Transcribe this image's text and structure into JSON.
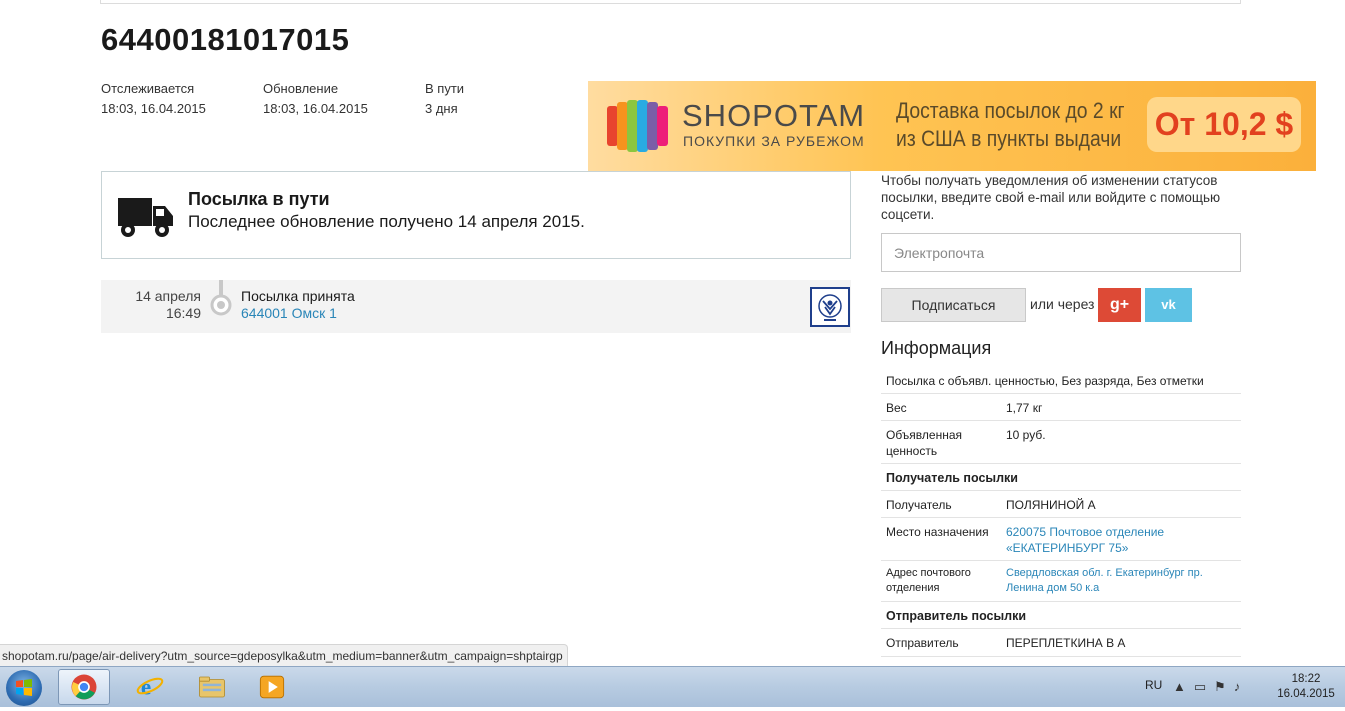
{
  "tracking": {
    "number": "64400181017015",
    "meta": [
      {
        "label": "Отслеживается",
        "value": "18:03, 16.04.2015"
      },
      {
        "label": "Обновление",
        "value": "18:03, 16.04.2015"
      },
      {
        "label": "В пути",
        "value": "3 дня"
      }
    ]
  },
  "banner": {
    "brand": "SHOPOTAM",
    "tagline": "ПОКУПКИ ЗА РУБЕЖОМ",
    "promo_line1": "Доставка посылок до 2 кг",
    "promo_line2": "из США в пункты выдачи",
    "price": "От 10,2 $"
  },
  "status": {
    "title": "Посылка в пути",
    "description": "Последнее обновление получено 14 апреля 2015."
  },
  "events": [
    {
      "date": "14 апреля",
      "time": "16:49",
      "name": "Посылка принята",
      "location": "644001 Омск 1"
    }
  ],
  "subscribe": {
    "text": "Чтобы получать уведомления об изменении статусов посылки, введите свой e-mail или войдите с помощью соцсети.",
    "email_placeholder": "Электропочта",
    "button_label": "Подписаться",
    "or_via": "или через",
    "gplus_label": "g+",
    "vk_label": "vk"
  },
  "info": {
    "title": "Информация",
    "parcel_type": "Посылка с объявл. ценностью, Без разряда, Без отметки",
    "weight_label": "Вес",
    "weight_value": "1,77 кг",
    "declared_label_1": "Объявленная",
    "declared_label_2": "ценность",
    "declared_value": "10 руб.",
    "recipient_section": "Получатель посылки",
    "recipient_label": "Получатель",
    "recipient_value": "ПОЛЯНИНОЙ А",
    "destination_label": "Место назначения",
    "destination_value_1": "620075 Почтовое отделение",
    "destination_value_2": "«ЕКАТЕРИНБУРГ 75»",
    "address_label_1": "Адрес почтового",
    "address_label_2": "отделения",
    "address_value_1": "Свердловская обл. г. Екатеринбург пр.",
    "address_value_2": "Ленина дом 50 к.а",
    "sender_section": "Отправитель посылки",
    "sender_label": "Отправитель",
    "sender_value": "ПЕРЕПЛЕТКИНА В А"
  },
  "statusbar": {
    "url": "shopotam.ru/page/air-delivery?utm_source=gdeposylka&utm_medium=banner&utm_campaign=shptairgp"
  },
  "taskbar": {
    "lang": "RU",
    "time": "18:22",
    "date": "16.04.2015"
  },
  "colors": {
    "accent_link": "#2a86b8",
    "gplus": "#dd4a36",
    "vk": "#5ec2e4",
    "banner_orange": "#fbb03b",
    "price_red": "#e2411f"
  }
}
